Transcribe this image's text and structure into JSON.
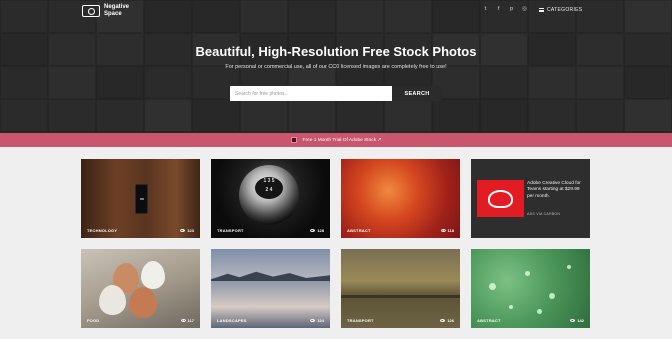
{
  "brand": {
    "line1": "Negative",
    "line2": "Space"
  },
  "social_icons": [
    {
      "name": "twitter-icon",
      "glyph": "t"
    },
    {
      "name": "facebook-icon",
      "glyph": "f"
    },
    {
      "name": "pinterest-icon",
      "glyph": "p"
    },
    {
      "name": "instagram-icon",
      "glyph": "◎"
    }
  ],
  "nav": {
    "categories_label": "CATEGORIES"
  },
  "hero": {
    "title": "Beautiful, High-Resolution Free Stock Photos",
    "subtitle": "For personal or commercial use, all of our CC0 licensed images are completely free to use!",
    "search_placeholder": "Search for free photos...",
    "search_button": "SEARCH"
  },
  "promo": {
    "text": "Free 1 Month Trial Of Adobe Stock ↗"
  },
  "cards": [
    {
      "category": "TECHNOLOGY",
      "views": "123"
    },
    {
      "category": "TRANSPORT",
      "views": "128"
    },
    {
      "category": "ABSTRACT",
      "views": "118"
    },
    {
      "category": "FOOD",
      "views": "117"
    },
    {
      "category": "LANDSCAPES",
      "views": "124"
    },
    {
      "category": "TRANSPORT",
      "views": "126"
    },
    {
      "category": "ABSTRACT",
      "views": "142"
    }
  ],
  "knob_labels": {
    "row1": "1 3 5",
    "row2": "2 4"
  },
  "ad": {
    "text": "Adobe Creative Cloud for Teams starting at $29.99 per month.",
    "via": "ADS VIA CARBON"
  },
  "colors": {
    "promo": "#c8566e",
    "hero_bg": "#2f2f2f",
    "page_bg": "#efefef",
    "adobe_red": "#e31b23"
  }
}
